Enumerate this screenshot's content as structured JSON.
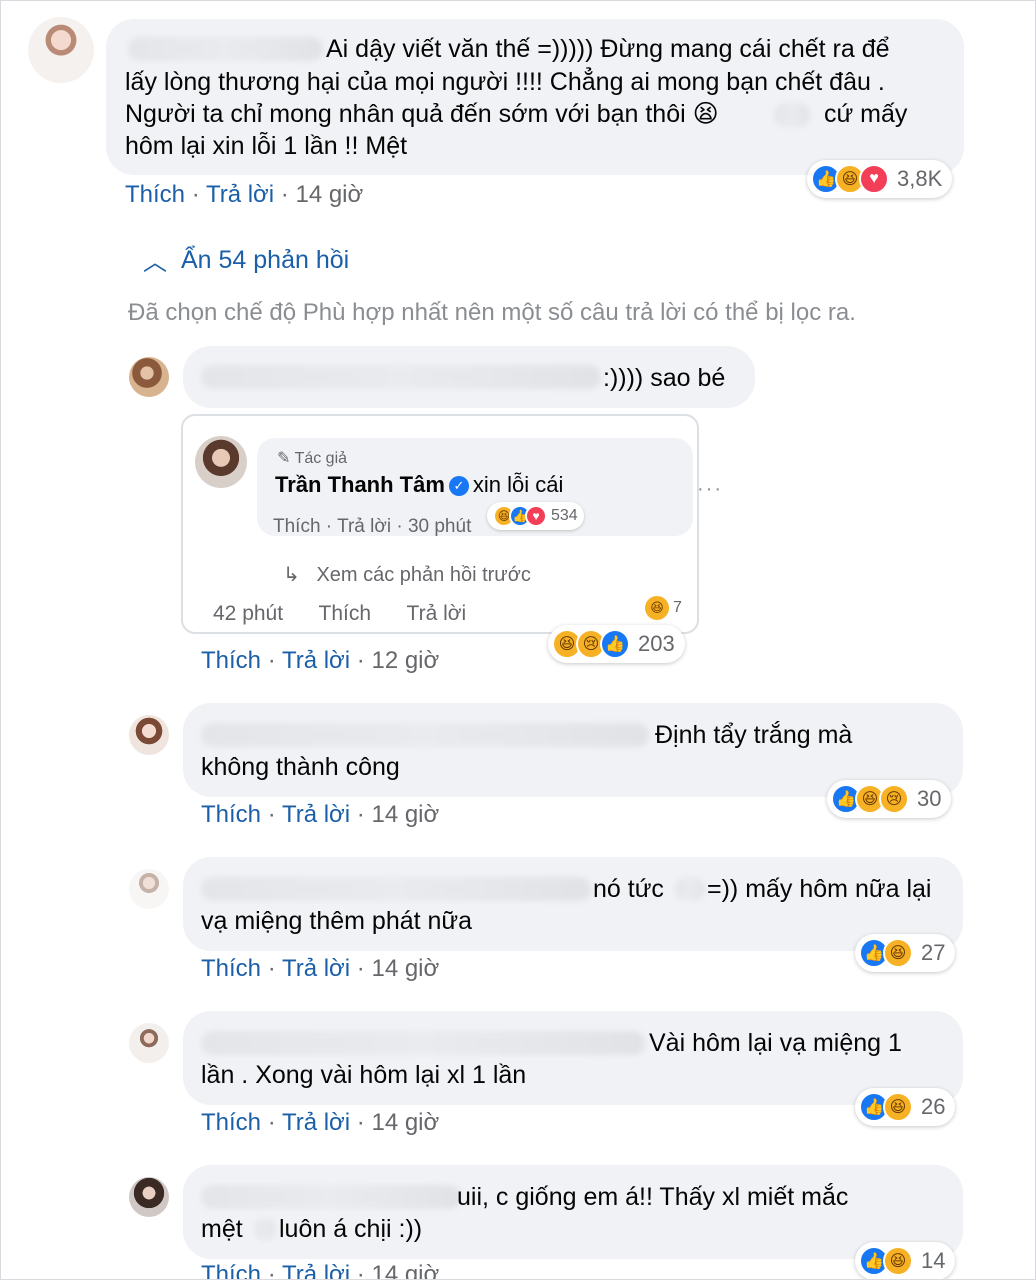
{
  "comments": [
    {
      "id": "c1",
      "lines": [
        "Ai dậy viết văn thế =))))) Đừng mang cái chết ra để",
        "lấy lòng thương hại của mọi người !!!! Chẳng ai mong bạn chết đâu .",
        "Người ta chỉ mong nhân quả đến sớm với bạn thôi 😫",
        "cứ mấy",
        "hôm lại xin lỗi 1 lần !! Mệt"
      ],
      "actions": {
        "like": "Thích",
        "reply": "Trả lời",
        "time": "14 giờ"
      },
      "reactions": {
        "icons": [
          "like-icon",
          "haha-icon",
          "love-icon"
        ],
        "count": "3,8K"
      }
    },
    {
      "id": "c2",
      "lines": [
        ":)))) sao bé"
      ],
      "actions": {
        "like": "Thích",
        "reply": "Trả lời",
        "time": "12 giờ"
      },
      "reactions": {
        "icons": [
          "haha-icon",
          "sad-icon",
          "like-icon"
        ],
        "count": "203"
      }
    },
    {
      "id": "c3",
      "lines": [
        "Định tẩy trắng mà",
        "không thành công"
      ],
      "actions": {
        "like": "Thích",
        "reply": "Trả lời",
        "time": "14 giờ"
      },
      "reactions": {
        "icons": [
          "like-icon",
          "haha-icon",
          "sad-icon"
        ],
        "count": "30"
      }
    },
    {
      "id": "c4",
      "lines": [
        "nó tức",
        "=)) mấy hôm nữa lại",
        "vạ miệng thêm phát nữa"
      ],
      "actions": {
        "like": "Thích",
        "reply": "Trả lời",
        "time": "14 giờ"
      },
      "reactions": {
        "icons": [
          "like-icon",
          "haha-icon"
        ],
        "count": "27"
      }
    },
    {
      "id": "c5",
      "lines": [
        "Vài hôm lại vạ miệng 1",
        "lần . Xong vài hôm lại xl 1 lần"
      ],
      "actions": {
        "like": "Thích",
        "reply": "Trả lời",
        "time": "14 giờ"
      },
      "reactions": {
        "icons": [
          "like-icon",
          "haha-icon"
        ],
        "count": "26"
      }
    },
    {
      "id": "c6",
      "lines": [
        "uii, c giống em á!! Thấy xl miết mắc",
        "mệt",
        "luôn á chịi :))"
      ],
      "actions": {
        "like": "Thích",
        "reply": "Trả lời",
        "time": "14 giờ"
      },
      "reactions": {
        "icons": [
          "like-icon",
          "haha-icon"
        ],
        "count": "14"
      }
    }
  ],
  "replies_toggle": "Ẩn 54 phản hồi",
  "filter_note": "Đã chọn chế độ Phù hợp nhất nên một số câu trả lời có thể bị lọc ra.",
  "quoted_screenshot": {
    "author_badge": "Tác giả",
    "author_name": "Trần Thanh Tâm",
    "text": "xin lỗi cái",
    "like": "Thích",
    "reply": "Trả lời",
    "time": "30 phút",
    "reaction_count": "534",
    "view_previous": "Xem các phản hồi trước",
    "bottom_time": "42 phút",
    "bottom_like": "Thích",
    "bottom_reply": "Trả lời",
    "bottom_reaction_count": "7"
  }
}
